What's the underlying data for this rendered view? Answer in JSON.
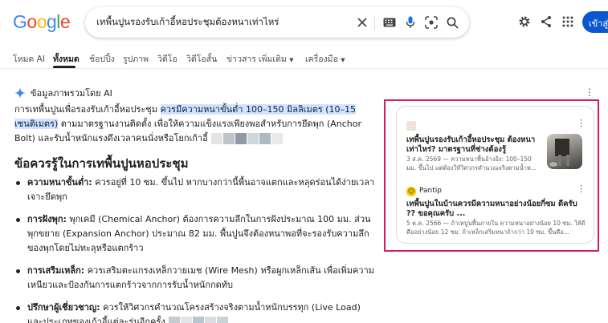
{
  "header": {
    "logo_letters": [
      "G",
      "o",
      "o",
      "g",
      "l",
      "e"
    ],
    "logo_colors": [
      "#4285f4",
      "#ea4335",
      "#fbbc05",
      "#4285f4",
      "#34a853",
      "#ea4335"
    ],
    "search_query": "เทพื้นปูนรองรับเก้าอี้หอประชุมต้องหนาเท่าไหร่",
    "signin_label": "เข้าสู่ระบบ"
  },
  "tabs": [
    "โหมด AI",
    "ทั้งหมด",
    "ช้อปปิ้ง",
    "รูปภาพ",
    "วิดีโอ",
    "วิดีโอสั้น",
    "ข่าวสาร",
    "เพิ่มเติม",
    "เครื่องมือ"
  ],
  "ai_overview": {
    "label": "ข้อมูลภาพรวมโดย AI",
    "intro_before": "การเทพื้นปูนเพื่อรองรับเก้าอี้หอประชุม ",
    "intro_highlight": "ควรมีความหนาขั้นต่ำ 100–150 มิลลิเมตร (10–15 เซนติเมตร)",
    "intro_after": " ตามมาตรฐานงานติดตั้ง เพื่อให้ความแข็งแรงเพียงพอสำหรับการยึดพุก (Anchor Bolt) และรับน้ำหนักแรงดึงเวลาคนนั่งหรือโยกเก้าอี้",
    "section_title": "ข้อควรรู้ในการเทพื้นปูนหอประชุม",
    "items": [
      {
        "title": "ความหนาขั้นต่ำ:",
        "text": " ควรอยู่ที่ 10 ซม. ขึ้นไป หากบางกว่านี้พื้นอาจแตกและหลุดร่อนได้ง่ายเวลาเจาะยึดพุก"
      },
      {
        "title": "การฝังพุก:",
        "text": " พุกเคมี (Chemical Anchor) ต้องการความลึกในการฝังประมาณ 100 มม. ส่วนพุกขยาย (Expansion Anchor) ประมาณ 82 มม. พื้นปูนจึงต้องหนาพอที่จะรองรับความลึกของพุกโดยไม่ทะลุหรือแตกร้าว"
      },
      {
        "title": "การเสริมเหล็ก:",
        "text": " ควรเสริมตะแกรงเหล็กวายเมช (Wire Mesh) หรือผูกเหล็กเส้น เพื่อเพิ่มความเหนียวและป้องกันการแตกร้าวจากการรับน้ำหนักกดทับ"
      },
      {
        "title": "ปรึกษาผู้เชี่ยวชาญ:",
        "text": " ควรให้วิศวกรคำนวณโครงสร้างจริงตามน้ำหนักบรรทุก (Live Load) และประเภทของเก้าอี้แต่ละรุ่นอีกครั้ง"
      }
    ]
  },
  "sources": [
    {
      "name": "",
      "title": "เทพื้นปูนรองรับเก้าอี้หอประชุม ต้องหนาเท่าไหร่? มาตรฐานที่ช่างต้องรู้",
      "snippet": "3 ส.ค. 2569 — ความหนาพื้นอ้างอิง: 100–150 มม. ขึ้นไป แต่ต้องให้วิศวกรคำนวณจริงตามน้ำห..."
    },
    {
      "name": "Pantip",
      "title": "เทพื้นปูนในบ้านควรมีความหนาอย่างน้อยกี่ซม ดีครับ ?? ขอคุณครับ ...",
      "snippet": "5 ต.ค. 2566 — ถ้าเทปูนพื้นภายใน ความหนาอย่างน้อย 10 ซม. ให้ดีคืออย่างน้อย 12 ซม. ถ้าเหล็กเสริมหนาถ้ากว่า 10 ซม. ขึ้นคือ..."
    }
  ]
}
